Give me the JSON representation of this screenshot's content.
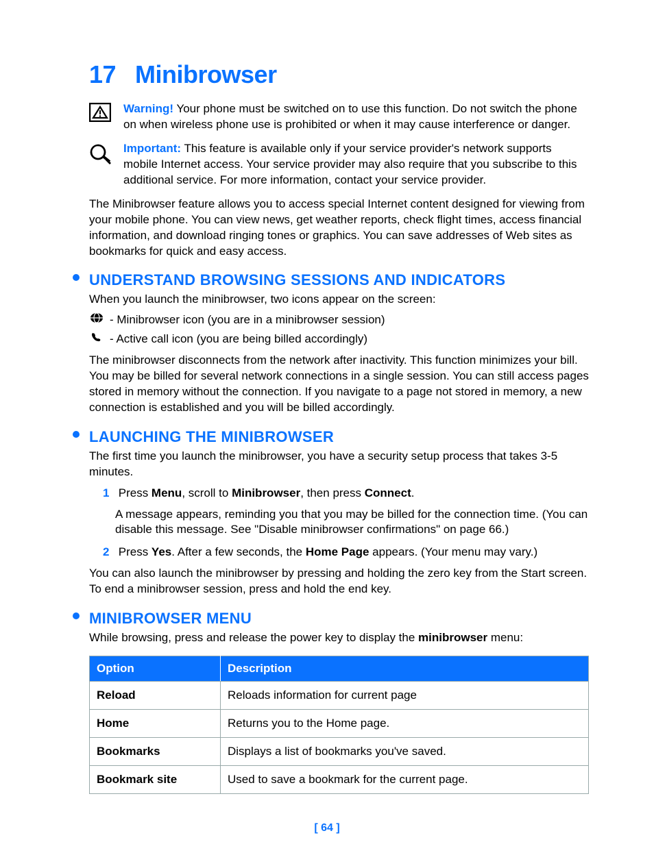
{
  "chapter": {
    "number": "17",
    "title": "Minibrowser"
  },
  "warning": {
    "label": "Warning!",
    "text": " Your phone must be switched on to use this function. Do not switch the phone on when wireless phone use is prohibited or when it may cause interference or danger."
  },
  "important": {
    "label": "Important:",
    "text": " This feature is available only if your service provider's network supports mobile Internet access. Your service provider may also require that you subscribe to this additional service. For more information, contact your service provider."
  },
  "intro": "The Minibrowser feature allows you to access special Internet content designed for viewing from your mobile phone. You can view news, get weather reports, check flight times, access financial information, and download ringing tones or graphics. You can save addresses of Web sites as bookmarks for quick and easy access.",
  "section1": {
    "heading": "UNDERSTAND BROWSING SESSIONS AND INDICATORS",
    "lead": "When you launch the minibrowser, two icons appear on the screen:",
    "icon1": " - Minibrowser icon (you are in a minibrowser session)",
    "icon2": " - Active call icon (you are being billed accordingly)",
    "para": "The minibrowser disconnects from the network after inactivity. This function minimizes your bill. You may be billed for several network connections in a single session. You can still access pages stored in memory without the connection. If you navigate to a page not stored in memory, a new connection is established and you will be billed accordingly."
  },
  "section2": {
    "heading": "LAUNCHING THE MINIBROWSER",
    "lead": "The first time you launch the minibrowser, you have a security setup process that takes 3-5 minutes.",
    "steps": [
      {
        "num": "1",
        "pre": "Press ",
        "b1": "Menu",
        "mid1": ", scroll to ",
        "b2": "Minibrowser",
        "mid2": ", then press ",
        "b3": "Connect",
        "post": ".",
        "sub": "A message appears, reminding you that you may be billed for the connection time. (You can disable this message. See \"Disable minibrowser confirmations\" on page 66.)"
      },
      {
        "num": "2",
        "pre": "Press ",
        "b1": "Yes",
        "mid1": ". After a few seconds, the ",
        "b2": "Home Page",
        "mid2": " appears. (Your menu may vary.)",
        "b3": "",
        "post": "",
        "sub": ""
      }
    ],
    "trail": "You can also launch the minibrowser by pressing and holding the zero key from the Start screen. To end a minibrowser session, press and hold the end key."
  },
  "section3": {
    "heading": "MINIBROWSER MENU",
    "lead_pre": "While browsing, press and release the power key to display the ",
    "lead_bold": "minibrowser",
    "lead_post": " menu:",
    "table": {
      "head": {
        "c1": "Option",
        "c2": "Description"
      },
      "rows": [
        {
          "c1": "Reload",
          "c2": "Reloads information for current page"
        },
        {
          "c1": "Home",
          "c2": "Returns you to the Home page."
        },
        {
          "c1": "Bookmarks",
          "c2": "Displays a list of bookmarks you've saved."
        },
        {
          "c1": "Bookmark site",
          "c2": "Used to save a bookmark for the current page."
        }
      ]
    }
  },
  "pageNumber": "[ 64 ]"
}
